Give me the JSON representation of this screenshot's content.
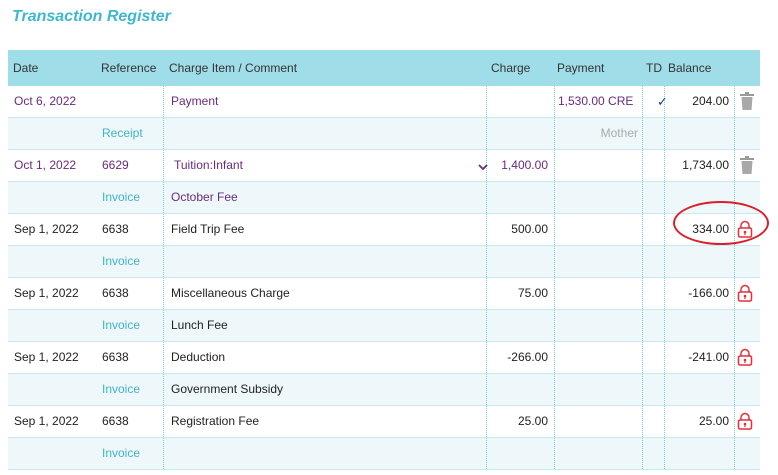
{
  "title": "Transaction Register",
  "headers": {
    "date": "Date",
    "reference": "Reference",
    "charge_item": "Charge Item / Comment",
    "charge": "Charge",
    "payment": "Payment",
    "td": "TD",
    "balance": "Balance"
  },
  "rows": [
    {
      "date": "Oct 6, 2022",
      "reference": "",
      "item": "Payment",
      "charge": "",
      "payment": "1,530.00  CRE",
      "td": "✓",
      "balance": "204.00",
      "type": "Receipt",
      "comment": "",
      "payer": "Mother",
      "action": "trash-icon"
    },
    {
      "date": "Oct 1, 2022",
      "reference": "6629",
      "item": "Tuition:Infant",
      "charge": "1,400.00",
      "payment": "",
      "td": "",
      "balance": "1,734.00",
      "type": "Invoice",
      "comment": "October Fee",
      "payer": "",
      "action": "trash-icon"
    },
    {
      "date": "Sep 1, 2022",
      "reference": "6638",
      "item": "Field Trip Fee",
      "charge": "500.00",
      "payment": "",
      "td": "",
      "balance": "334.00",
      "type": "Invoice",
      "comment": "",
      "payer": "",
      "action": "lock-icon"
    },
    {
      "date": "Sep 1, 2022",
      "reference": "6638",
      "item": "Miscellaneous Charge",
      "charge": "75.00",
      "payment": "",
      "td": "",
      "balance": "-166.00",
      "type": "Invoice",
      "comment": "Lunch Fee",
      "payer": "",
      "action": "lock-icon"
    },
    {
      "date": "Sep 1, 2022",
      "reference": "6638",
      "item": "Deduction",
      "charge": "-266.00",
      "payment": "",
      "td": "",
      "balance": "-241.00",
      "type": "Invoice",
      "comment": "Government Subsidy",
      "payer": "",
      "action": "lock-icon"
    },
    {
      "date": "Sep 1, 2022",
      "reference": "6638",
      "item": "Registration Fee",
      "charge": "25.00",
      "payment": "",
      "td": "",
      "balance": "25.00",
      "type": "Invoice",
      "comment": "",
      "payer": "",
      "action": "lock-icon"
    }
  ],
  "colors": {
    "header_bg": "#9fdde9",
    "title": "#3fb8cf",
    "purple": "#6a2b7a",
    "teal": "#3fb3c9",
    "highlight_circle": "#d81f2a",
    "lock": "#e0303a"
  }
}
